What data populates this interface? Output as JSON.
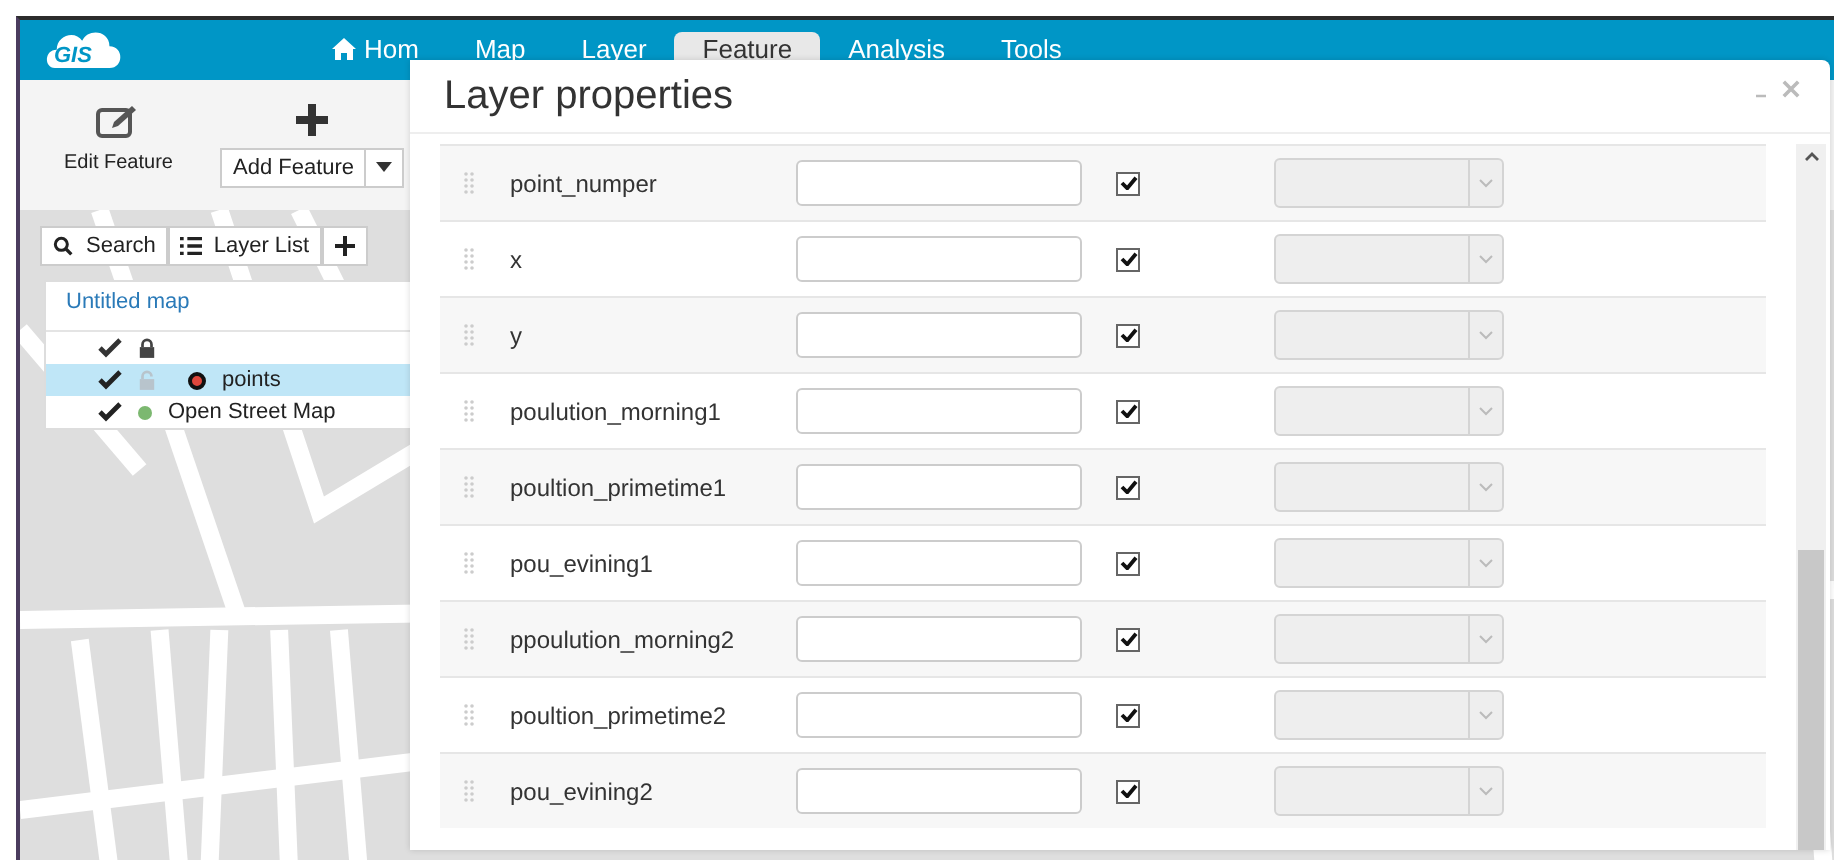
{
  "header": {
    "logo": "GIS",
    "nav": [
      {
        "label": "Hom",
        "kind": "home",
        "selected": false
      },
      {
        "label": "Map",
        "kind": "plain",
        "selected": false
      },
      {
        "label": "Layer",
        "kind": "plain",
        "selected": false
      },
      {
        "label": "Feature",
        "kind": "plain",
        "selected": true
      },
      {
        "label": "Analysis",
        "kind": "plain",
        "selected": false
      },
      {
        "label": "Tools",
        "kind": "plain",
        "selected": false
      }
    ]
  },
  "toolbar": {
    "edit_label": "Edit Feature",
    "add_label": "Add Feature"
  },
  "map_tools": [
    "Search",
    "Layer List"
  ],
  "layer_panel": {
    "title": "Untitled map",
    "layers": [
      {
        "name": "points",
        "kind": "vector",
        "selected": true,
        "visible": true,
        "locked": false,
        "color": "#e0473c"
      },
      {
        "name": "Open Street Map",
        "kind": "basemap",
        "selected": false,
        "visible": true,
        "color": "#7cb870"
      }
    ]
  },
  "dialog": {
    "title": "Layer properties",
    "fields": [
      {
        "name": "point_numper",
        "checked": true,
        "disabled": true
      },
      {
        "name": "x",
        "checked": true,
        "disabled": true
      },
      {
        "name": "y",
        "checked": true,
        "disabled": true
      },
      {
        "name": "poulution_morning1",
        "checked": true,
        "disabled": true
      },
      {
        "name": "poultion_primetime1",
        "checked": true,
        "disabled": true
      },
      {
        "name": "pou_evining1",
        "checked": true,
        "disabled": true
      },
      {
        "name": "ppoulution_morning2",
        "checked": true,
        "disabled": true
      },
      {
        "name": "poultion_primetime2",
        "checked": true,
        "disabled": true
      },
      {
        "name": "pou_evining2",
        "checked": true,
        "disabled": true
      }
    ]
  }
}
